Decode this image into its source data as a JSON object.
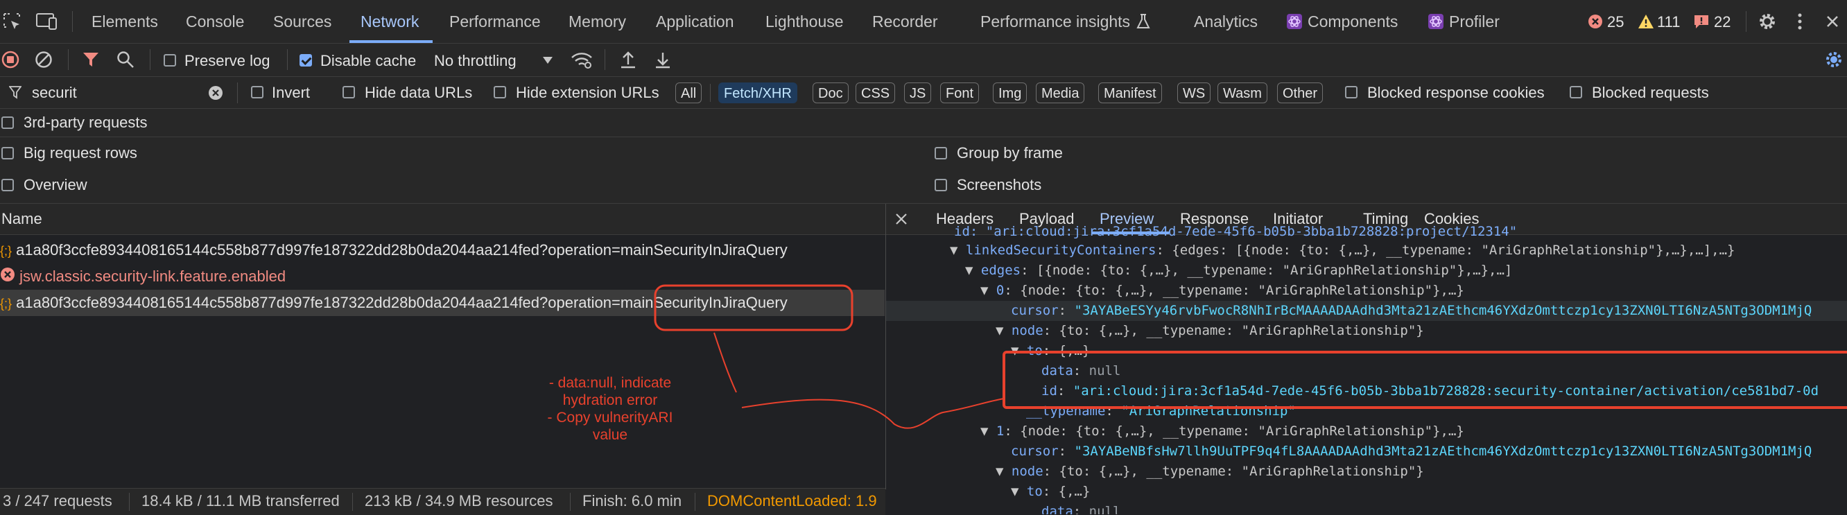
{
  "tabs": [
    "Elements",
    "Console",
    "Sources",
    "Network",
    "Performance",
    "Memory",
    "Application",
    "Lighthouse",
    "Recorder",
    "Performance insights",
    "Analytics",
    "Components",
    "Profiler"
  ],
  "counts": {
    "errors": "25",
    "warnings": "111",
    "issues": "22"
  },
  "toolbar": {
    "preserve_log": "Preserve log",
    "disable_cache": "Disable cache",
    "throttling": "No throttling"
  },
  "filter": {
    "value": "securit",
    "invert": "Invert",
    "hide_data": "Hide data URLs",
    "hide_ext": "Hide extension URLs",
    "types": [
      "All",
      "Fetch/XHR",
      "Doc",
      "CSS",
      "JS",
      "Font",
      "Img",
      "Media",
      "Manifest",
      "WS",
      "Wasm",
      "Other"
    ],
    "blocked_cookies": "Blocked response cookies",
    "blocked_requests": "Blocked requests",
    "third_party": "3rd-party requests"
  },
  "options": {
    "big_rows": "Big request rows",
    "group_frame": "Group by frame",
    "overview": "Overview",
    "screenshots": "Screenshots"
  },
  "table": {
    "header": "Name",
    "requests": [
      "a1a80f3ccfe8934408165144c558b877d997fe187322dd28b0da2044aa214fed?operation=mainSecurityInJiraQuery",
      "jsw.classic.security-link.feature.enabled",
      "a1a80f3ccfe8934408165144c558b877d997fe187322dd28b0da2044aa214fed?operation=mainSecurityInJiraQuery"
    ]
  },
  "annotation": [
    "- data:null, indicate",
    "hydration error",
    "- Copy vulnerityARI",
    "value"
  ],
  "panel_tabs": [
    "Headers",
    "Payload",
    "Preview",
    "Response",
    "Initiator",
    "Timing",
    "Cookies"
  ],
  "preview": {
    "top_cut": "id: \"ari:cloud:jira:3cf1a54d-7ede-45f6-b05b-3bba1b728828:project/12314\"",
    "l1_key": "linkedSecurityContainers",
    "l1_val": "{edges: [{node: {to: {,…}, __typename: \"AriGraphRelationship\"},…},…],…}",
    "l2_key": "edges",
    "l2_val": "[{node: {to: {,…}, __typename: \"AriGraphRelationship\"},…},…]",
    "l3_key": "0",
    "l3_val": "{node: {to: {,…}, __typename: \"AriGraphRelationship\"},…}",
    "cursor0": "\"3AYABeESYy46rvbFwocR8NhIrBcMAAAADAAdhd3Mta21zAEthcm46YXdzOmttczp1cy13ZXN0LTI6NzA5NTg3ODM1MjQ",
    "node_key": "node",
    "node_val": "{to: {,…}, __typename: \"AriGraphRelationship\"}",
    "to_key": "to",
    "to_val": "{,…}",
    "data_key": "data",
    "data_val": "null",
    "id_key": "id",
    "id_val": "\"ari:cloud:jira:3cf1a54d-7ede-45f6-b05b-3bba1b728828:security-container/activation/ce581bd7-0d",
    "typename_key": "__typename",
    "typename_val": "\"AriGraphRelationship\"",
    "l3b_key": "1",
    "cursor1": "\"3AYABeNBfsHw7llh9UuTPF9q4fL8AAAADAAdhd3Mta21zAEthcm46YXdzOmttczp1cy13ZXN0LTI6NzA5NTg3ODM1MjQ",
    "cursor_key": "cursor"
  },
  "status": {
    "requests": "3 / 247 requests",
    "transferred": "18.4 kB / 11.1 MB transferred",
    "resources": "213 kB / 34.9 MB resources",
    "finish": "Finish: 6.0 min",
    "dcl": "DOMContentLoaded: 1.9"
  },
  "colors": {
    "accent": "#7cacf8",
    "annotation": "#e8412d",
    "error": "#f28b82",
    "warning": "#fdd663"
  }
}
